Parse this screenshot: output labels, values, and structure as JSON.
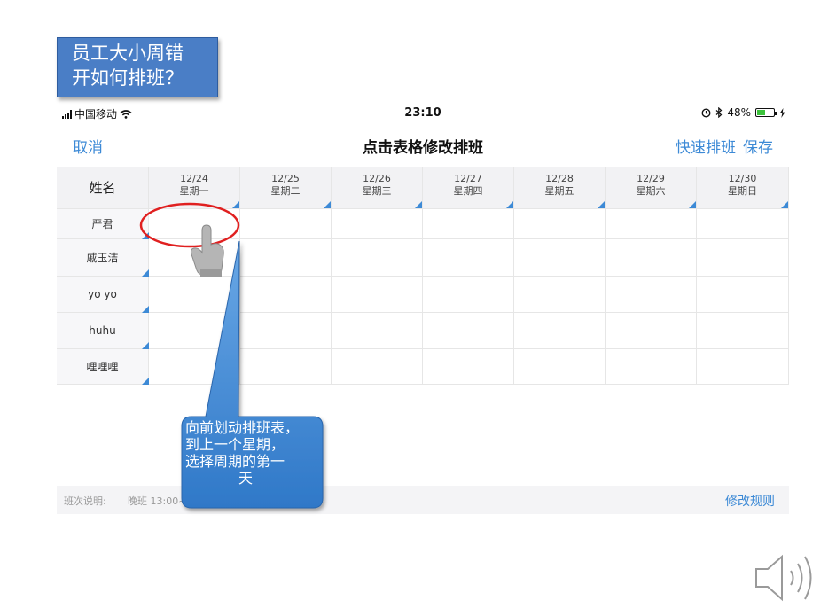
{
  "slide_title": [
    "员工大小周错",
    "开如何排班？"
  ],
  "status_bar": {
    "carrier": "中国移动",
    "time": "23:10",
    "battery": "48%"
  },
  "nav": {
    "cancel": "取消",
    "title": "点击表格修改排班",
    "quick_schedule": "快速排班",
    "save": "保存"
  },
  "table": {
    "name_header": "姓名",
    "days": [
      {
        "date": "12/24",
        "weekday": "星期一"
      },
      {
        "date": "12/25",
        "weekday": "星期二"
      },
      {
        "date": "12/26",
        "weekday": "星期三"
      },
      {
        "date": "12/27",
        "weekday": "星期四"
      },
      {
        "date": "12/28",
        "weekday": "星期五"
      },
      {
        "date": "12/29",
        "weekday": "星期六"
      },
      {
        "date": "12/30",
        "weekday": "星期日"
      }
    ],
    "employees": [
      "严君",
      "戚玉洁",
      "yo yo",
      "huhu",
      "哩哩哩"
    ]
  },
  "footer": {
    "label": "班次说明:",
    "shift": "晚班 13:00~",
    "rules": "修改规则"
  },
  "callout": {
    "lines": [
      "向前划动排班表，",
      "到上一个星期，",
      "选择周期的第一",
      "天"
    ]
  },
  "colors": {
    "accent": "#3d8ad6",
    "title_box": "#4a7ec6",
    "callout": "#4a8fd8",
    "highlight_ring": "#e02020"
  },
  "icons": [
    "signal-icon",
    "wifi-icon",
    "alarm-icon",
    "bluetooth-icon",
    "battery-icon",
    "charging-icon",
    "hand-pointer-icon",
    "speaker-icon"
  ]
}
